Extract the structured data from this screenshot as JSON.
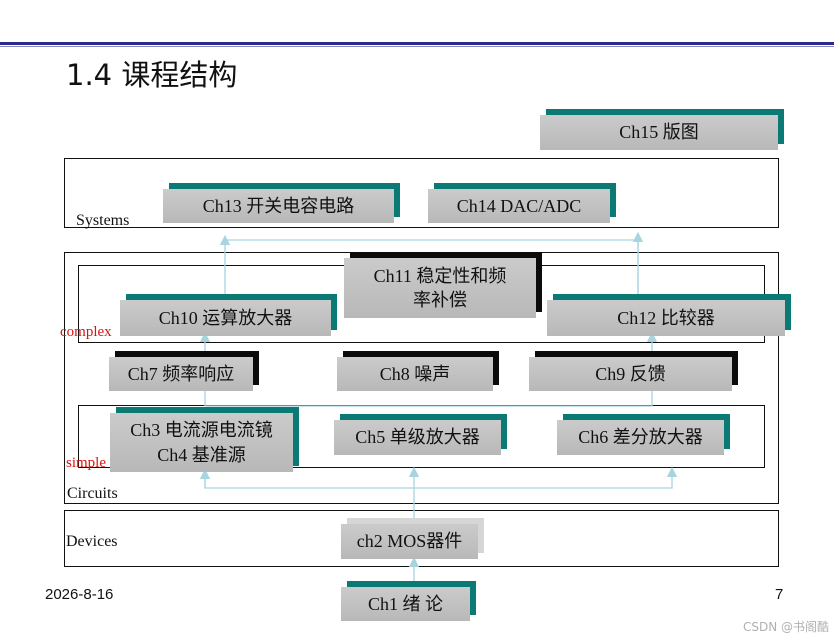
{
  "title": "1.4 课程结构",
  "sections": {
    "systems": "Systems",
    "complex": "complex",
    "simple": "simple",
    "circuits": "Circuits",
    "devices": "Devices"
  },
  "chapters": {
    "ch15": "Ch15 版图",
    "ch13": "Ch13 开关电容电路",
    "ch14": "Ch14 DAC/ADC",
    "ch11_line1": "Ch11 稳定性和频",
    "ch11_line2": "率补偿",
    "ch10": "Ch10 运算放大器",
    "ch12": "Ch12 比较器",
    "ch7": "Ch7 频率响应",
    "ch8": "Ch8 噪声",
    "ch9": "Ch9 反馈",
    "ch3_ch4_line1": "Ch3 电流源电流镜",
    "ch3_ch4_line2": "Ch4 基准源",
    "ch5": "Ch5 单级放大器",
    "ch6": "Ch6 差分放大器",
    "ch2": "ch2 MOS器件",
    "ch1": "Ch1   绪   论"
  },
  "footer": {
    "date": "2026-8-16",
    "page": "7"
  },
  "watermark": "CSDN @书阁酷",
  "colors": {
    "box_fill": "#c2c2c2",
    "teal_edge": "#0c7a74",
    "black_edge": "#0b0b0b",
    "arrow": "#a8d4e0",
    "header_line": "#2a2a8a",
    "red_label": "#dd1111"
  }
}
